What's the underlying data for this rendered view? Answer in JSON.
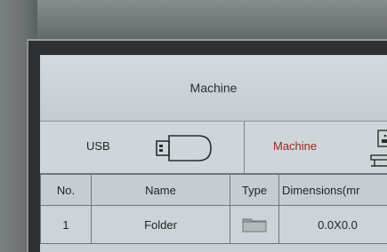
{
  "header": {
    "title": "Machine"
  },
  "tabs": {
    "usb_label": "USB",
    "machine_label": "Machine"
  },
  "table": {
    "columns": [
      "No.",
      "Name",
      "Type",
      "Dimensions(mr"
    ],
    "rows": [
      {
        "no": "1",
        "name": "Folder",
        "type_icon": "folder-icon",
        "dimensions": "0.0X0.0"
      }
    ]
  },
  "colors": {
    "screen_background": "#c9d0d4",
    "active_tab_text": "#9c2424",
    "text": "#25282b"
  }
}
